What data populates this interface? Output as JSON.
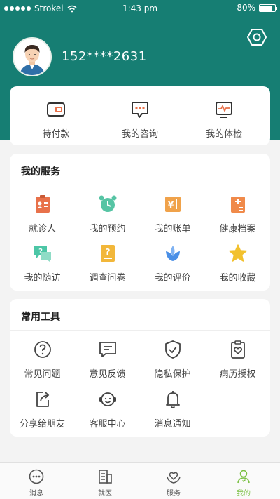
{
  "status_bar": {
    "carrier": "Strokei",
    "time": "1:43 pm",
    "battery": "80%",
    "battery_level": 0.8
  },
  "profile": {
    "phone": "152****2631"
  },
  "orders": [
    {
      "label": "待付款",
      "icon": "wallet-icon"
    },
    {
      "label": "我的咨询",
      "icon": "chat-bubble-icon"
    },
    {
      "label": "我的体检",
      "icon": "checkup-monitor-icon"
    }
  ],
  "services": {
    "title": "我的服务",
    "items": [
      {
        "label": "就诊人",
        "icon": "patient-card-icon",
        "color": "#e8714a"
      },
      {
        "label": "我的预约",
        "icon": "alarm-clock-icon",
        "color": "#56c4a4"
      },
      {
        "label": "我的账单",
        "icon": "bill-icon",
        "color": "#f0a24a"
      },
      {
        "label": "健康档案",
        "icon": "health-record-icon",
        "color": "#f08a4a"
      },
      {
        "label": "我的随访",
        "icon": "follow-up-chat-icon",
        "color": "#4cc6a6"
      },
      {
        "label": "调查问卷",
        "icon": "questionnaire-icon",
        "color": "#f2b73a"
      },
      {
        "label": "我的评价",
        "icon": "flower-icon",
        "color": "#4a8fe6"
      },
      {
        "label": "我的收藏",
        "icon": "star-icon",
        "color": "#f2c12e"
      }
    ]
  },
  "tools": {
    "title": "常用工具",
    "items": [
      {
        "label": "常见问题",
        "icon": "question-circle-icon"
      },
      {
        "label": "意见反馈",
        "icon": "feedback-icon"
      },
      {
        "label": "隐私保护",
        "icon": "shield-check-icon"
      },
      {
        "label": "病历授权",
        "icon": "record-authorize-icon"
      },
      {
        "label": "分享给朋友",
        "icon": "share-icon"
      },
      {
        "label": "客服中心",
        "icon": "customer-service-icon"
      },
      {
        "label": "消息通知",
        "icon": "bell-icon"
      }
    ]
  },
  "tabbar": [
    {
      "label": "消息",
      "icon": "message-dots-icon",
      "active": false
    },
    {
      "label": "就医",
      "icon": "hospital-building-icon",
      "active": false
    },
    {
      "label": "服务",
      "icon": "heart-hands-icon",
      "active": false
    },
    {
      "label": "我的",
      "icon": "person-icon",
      "active": true
    }
  ],
  "colors": {
    "header": "#167e73",
    "active_tab": "#7bc043",
    "background": "#f3f3f3"
  }
}
